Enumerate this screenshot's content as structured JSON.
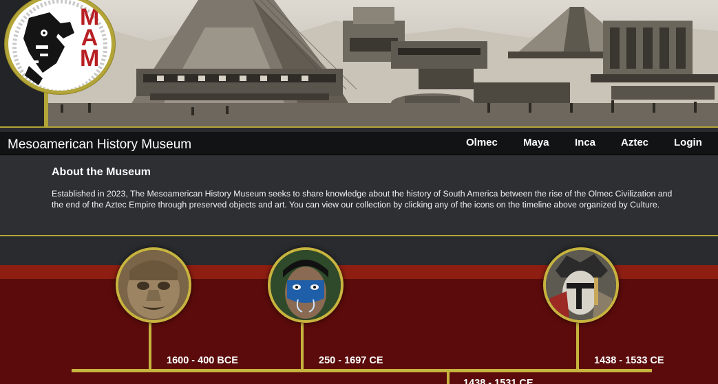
{
  "header": {
    "logo_text": "MAM",
    "site_title": "Mesoamerican History Museum"
  },
  "nav": {
    "links": [
      "Olmec",
      "Maya",
      "Inca",
      "Aztec",
      "Login"
    ]
  },
  "about": {
    "title": "About the Museum",
    "body": "Established in 2023, The Mesoamerican History Museum seeks to share knowledge about the history of South America between the rise of the Olmec Civilization and the end of the Aztec Empire through preserved objects and art. You can view our collection by clicking any of the icons on the timeline above organized by Culture."
  },
  "timeline": {
    "entries": [
      {
        "culture": "Olmec",
        "dates": "1600 - 400 BCE"
      },
      {
        "culture": "Maya",
        "dates": "250 - 1697 CE"
      },
      {
        "culture": "Aztec",
        "dates": "1438 - 1533 CE"
      }
    ],
    "partial_date": "1438 - 1531 CE"
  },
  "colors": {
    "gold": "#b3a537",
    "logo_red": "#b71f23",
    "timeline_red": "#5b0b0b",
    "timeline_band": "#8f1e12"
  }
}
